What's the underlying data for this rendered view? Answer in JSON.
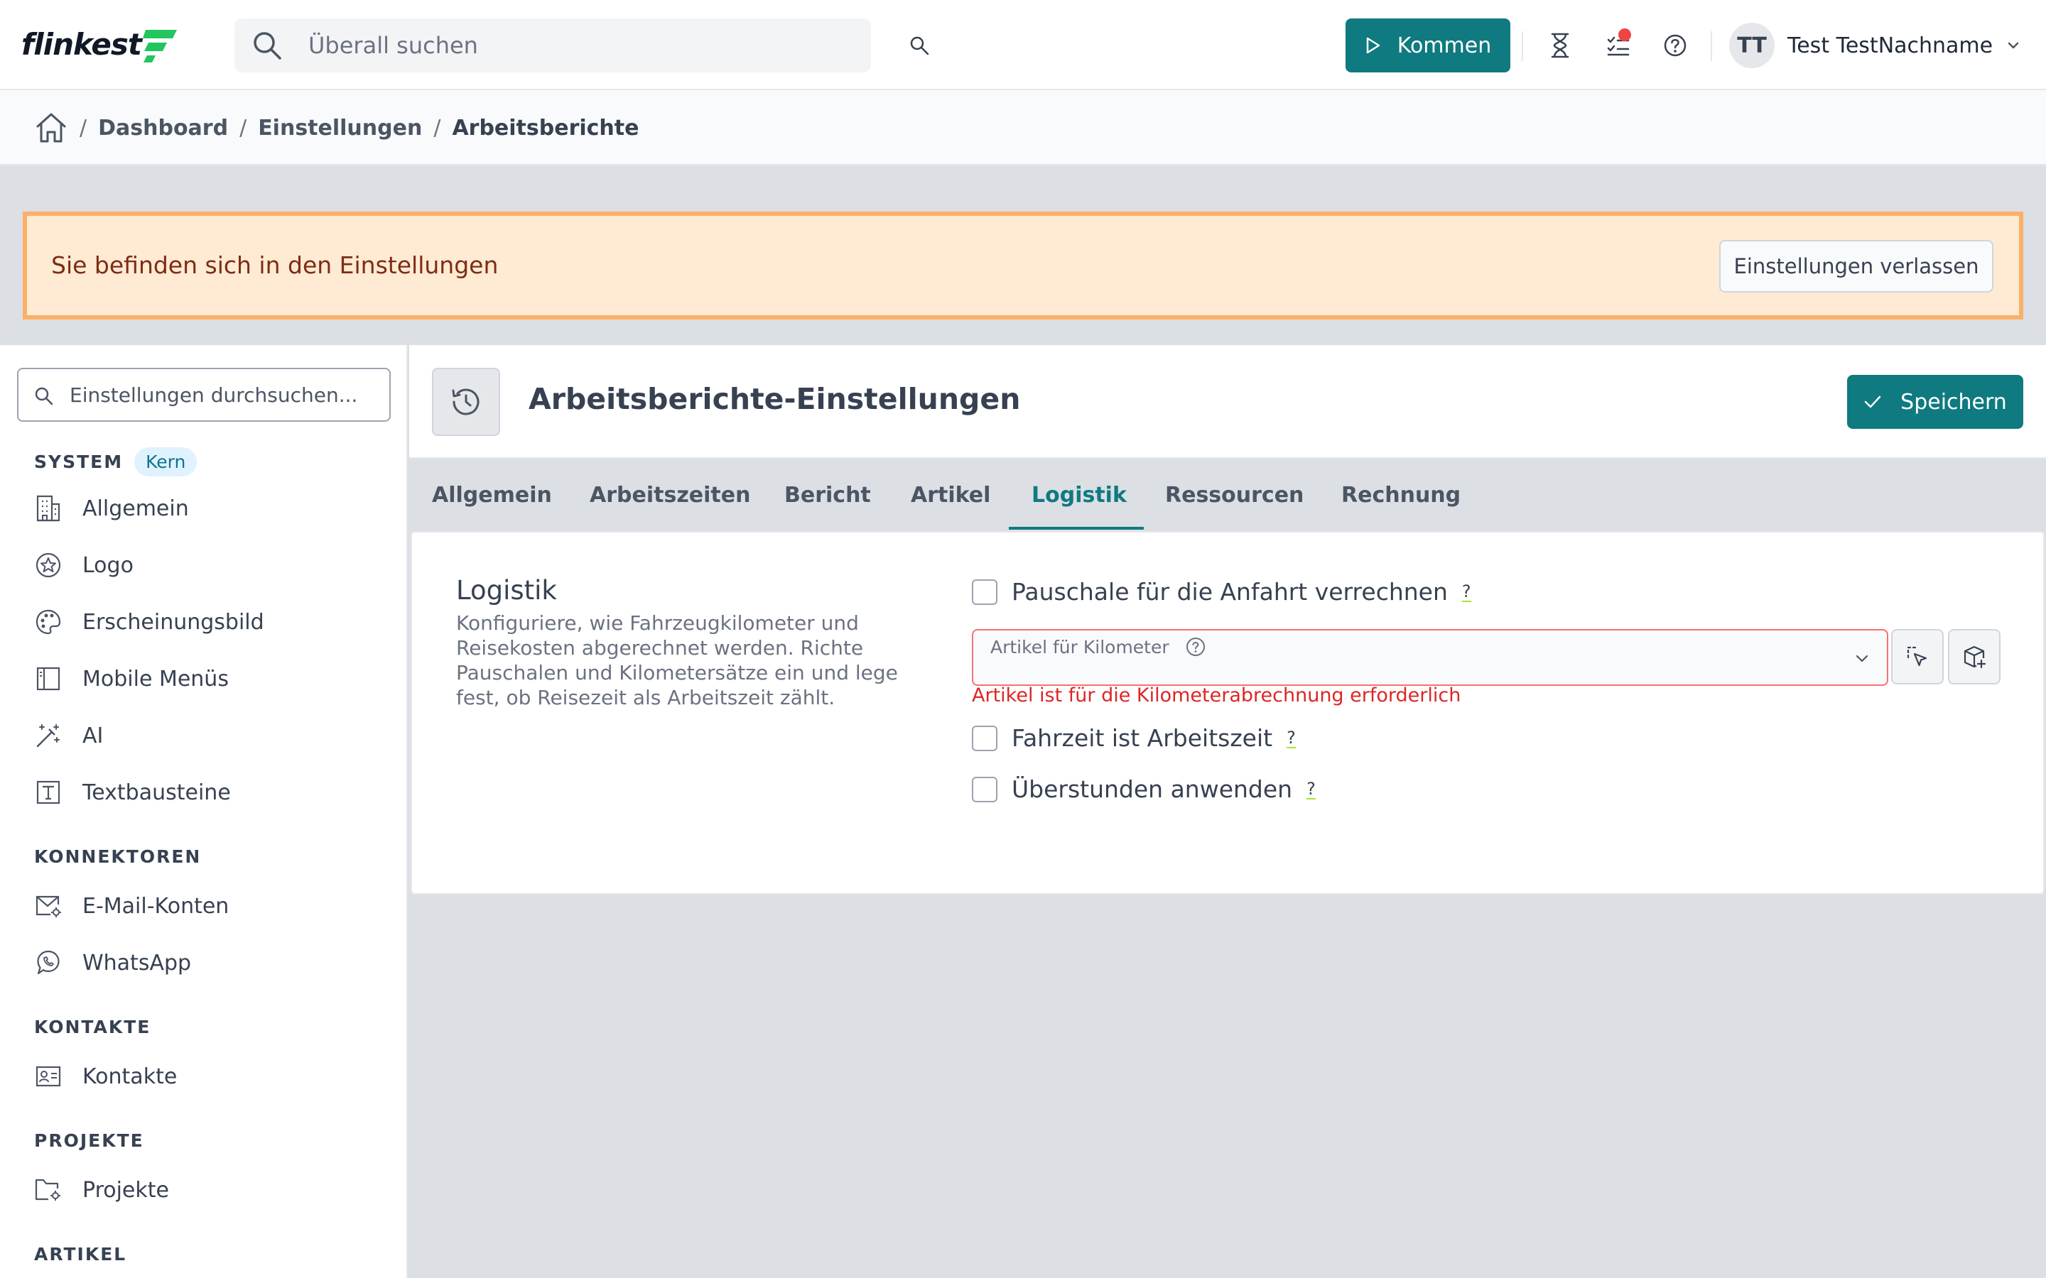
{
  "header": {
    "logo_text": "flinkest",
    "search_placeholder": "Überall suchen",
    "kommen_label": "Kommen",
    "user": {
      "initials": "TT",
      "name": "Test TestNachname"
    },
    "accent_color": "#0f7a80",
    "notification_color": "#ef4444"
  },
  "breadcrumb": {
    "items": [
      "Dashboard",
      "Einstellungen"
    ],
    "current": "Arbeitsberichte"
  },
  "banner": {
    "text": "Sie befinden sich in den Einstellungen",
    "button_label": "Einstellungen verlassen"
  },
  "sidebar": {
    "search_placeholder": "Einstellungen durchsuchen...",
    "sections": [
      {
        "title": "SYSTEM",
        "badge": "Kern",
        "items": [
          {
            "label": "Allgemein",
            "icon": "building-icon"
          },
          {
            "label": "Logo",
            "icon": "badge-star-icon"
          },
          {
            "label": "Erscheinungsbild",
            "icon": "palette-icon"
          },
          {
            "label": "Mobile Menüs",
            "icon": "panel-left-icon"
          },
          {
            "label": "AI",
            "icon": "magic-wand-icon"
          },
          {
            "label": "Textbausteine",
            "icon": "text-box-icon"
          }
        ]
      },
      {
        "title": "KONNEKTOREN",
        "items": [
          {
            "label": "E-Mail-Konten",
            "icon": "mail-settings-icon"
          },
          {
            "label": "WhatsApp",
            "icon": "whatsapp-icon"
          }
        ]
      },
      {
        "title": "KONTAKTE",
        "items": [
          {
            "label": "Kontakte",
            "icon": "contact-card-icon"
          }
        ]
      },
      {
        "title": "PROJEKTE",
        "items": [
          {
            "label": "Projekte",
            "icon": "folder-settings-icon"
          }
        ]
      },
      {
        "title": "ARTIKEL",
        "items": []
      }
    ]
  },
  "page": {
    "title": "Arbeitsberichte-Einstellungen",
    "save_label": "Speichern",
    "tabs": [
      "Allgemein",
      "Arbeitszeiten",
      "Bericht",
      "Artikel",
      "Logistik",
      "Ressourcen",
      "Rechnung"
    ],
    "active_tab": "Logistik"
  },
  "logistik": {
    "title": "Logistik",
    "description": "Konfiguriere, wie Fahrzeugkilometer und Reisekosten abgerechnet werden. Richte Pauschalen und Kilometersätze ein und lege fest, ob Reisezeit als Arbeitszeit zählt.",
    "pauschale_label": "Pauschale für die Anfahrt verrechnen",
    "pauschale_checked": false,
    "km_article_label": "Artikel für Kilometer",
    "km_article_value": "",
    "km_error": "Artikel ist für die Kilometerabrechnung erforderlich",
    "fahrzeit_label": "Fahrzeit ist Arbeitszeit",
    "fahrzeit_checked": false,
    "ueberstunden_label": "Überstunden anwenden",
    "ueberstunden_checked": false,
    "help_mark": "?",
    "error_color": "#dc2626"
  }
}
